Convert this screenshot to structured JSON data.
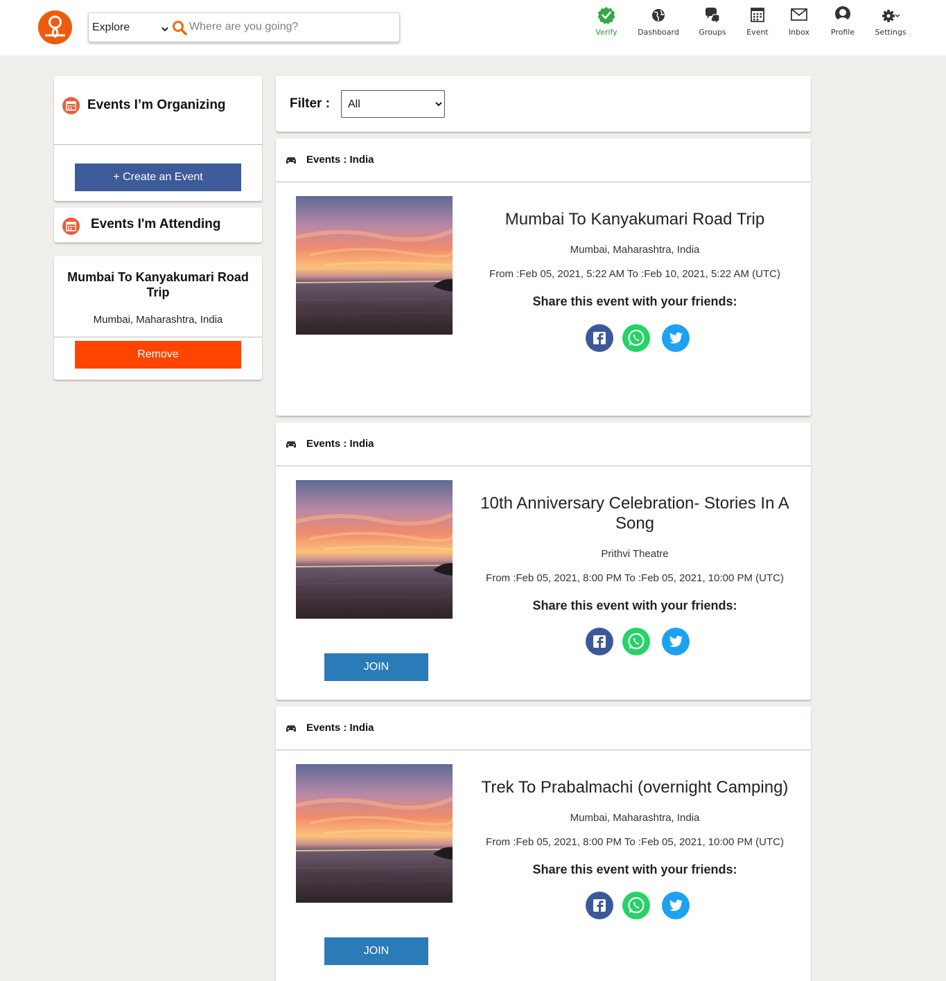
{
  "header": {
    "search": {
      "scope": "Explore",
      "placeholder": "Where are you going?"
    },
    "nav": [
      {
        "label": "Verify",
        "icon": "check-badge-icon"
      },
      {
        "label": "Dashboard",
        "icon": "globe-icon"
      },
      {
        "label": "Groups",
        "icon": "chat-bubbles-icon"
      },
      {
        "label": "Event",
        "icon": "calendar-icon"
      },
      {
        "label": "Inbox",
        "icon": "envelope-icon"
      },
      {
        "label": "Profile",
        "icon": "user-icon"
      },
      {
        "label": "Settings",
        "icon": "gear-icon"
      }
    ]
  },
  "sidebar": {
    "organizing": {
      "title": "Events I’m Organizing",
      "button": "+ Create an Event"
    },
    "attending": {
      "title": "Events I'm Attending"
    },
    "attending_event": {
      "title": "Mumbai To Kanyakumari Road Trip",
      "location": "Mumbai, Maharashtra, India",
      "button": "Remove"
    }
  },
  "filter": {
    "label": "Filter :",
    "selected": "All"
  },
  "events": [
    {
      "category": "Events : India",
      "title": "Mumbai To Kanyakumari Road Trip",
      "location": "Mumbai, Maharashtra, India",
      "dates": "From :Feb 05, 2021, 5:22 AM To :Feb 10, 2021, 5:22 AM (UTC)",
      "share": "Share this event with your friends:"
    },
    {
      "category": "Events : India",
      "title": "10th Anniversary Celebration- Stories In A Song",
      "location": "Prithvi Theatre",
      "dates": "From :Feb 05, 2021, 8:00 PM To :Feb 05, 2021, 10:00 PM (UTC)",
      "share": "Share this event with your friends:",
      "button": "JOIN"
    },
    {
      "category": "Events : India",
      "title": "Trek To Prabalmachi (overnight Camping)",
      "location": "Mumbai, Maharashtra, India",
      "dates": "From :Feb 05, 2021, 8:00 PM To :Feb 05, 2021, 10:00 PM (UTC)",
      "share": "Share this event with your friends:",
      "button": "JOIN"
    }
  ],
  "colors": {
    "brand": "#ef5b0c",
    "create_button": "#3d5a99",
    "remove_button": "#ff4500",
    "join_button": "#2b7bb9",
    "verify": "#2e9b2e",
    "facebook": "#3b5998",
    "whatsapp": "#25d366",
    "twitter": "#1da1f2"
  }
}
